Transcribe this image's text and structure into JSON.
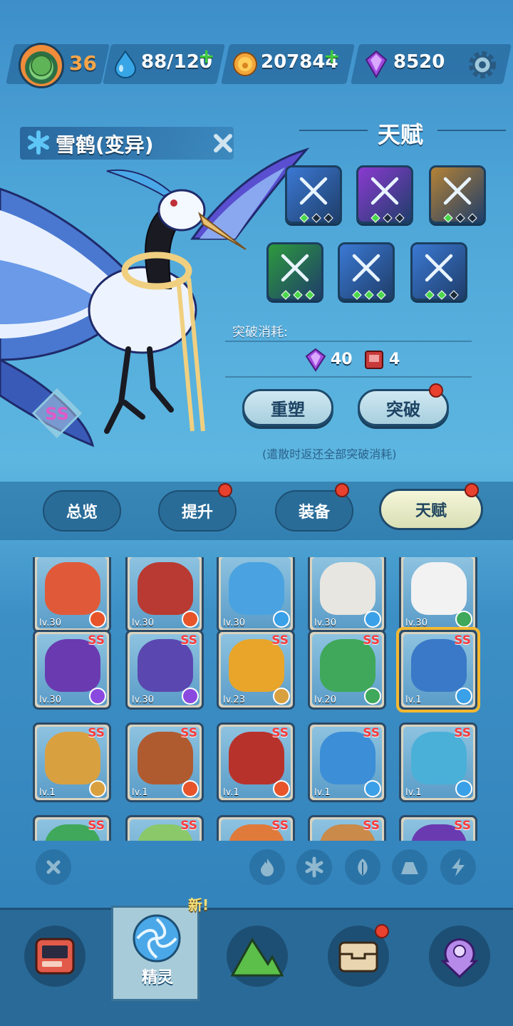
{
  "header": {
    "player_level": "36",
    "stamina": "88/120",
    "coins": "207844",
    "gems": "8520"
  },
  "creature": {
    "name": "雪鹤(变异)",
    "rank": "SS",
    "element": "ice"
  },
  "talent": {
    "title": "天赋",
    "skills": [
      {
        "icon": "x-slash-icon",
        "color": "#3b79d4",
        "filled_dots": 1
      },
      {
        "icon": "purple-slash-icon",
        "color": "#8a3ad0",
        "filled_dots": 1
      },
      {
        "icon": "golden-bowl-icon",
        "color": "#b58235",
        "filled_dots": 1
      },
      {
        "icon": "green-claw-icon",
        "color": "#2d9a3e",
        "filled_dots": 3
      },
      {
        "icon": "x-slash-icon",
        "color": "#3b79d4",
        "filled_dots": 3
      },
      {
        "icon": "ice-spike-icon",
        "color": "#3b79d4",
        "filled_dots": 2
      }
    ],
    "cost_label": "突破消耗:",
    "cost_gems": "40",
    "cost_books": "4",
    "reforge_label": "重塑",
    "breakthrough_label": "突破",
    "note": "(遣散时返还全部突破消耗)"
  },
  "tabs": [
    {
      "label": "总览",
      "badge": false
    },
    {
      "label": "提升",
      "badge": true
    },
    {
      "label": "装备",
      "badge": true
    },
    {
      "label": "天赋",
      "badge": true,
      "active": true
    }
  ],
  "cards": [
    {
      "lv": "lv.30",
      "ss": "",
      "color": "#e05a3a",
      "bg": "#f0c46a",
      "element": "fire"
    },
    {
      "lv": "lv.30",
      "ss": "",
      "color": "#b83a32",
      "bg": "#f0c46a",
      "element": "fire"
    },
    {
      "lv": "lv.30",
      "ss": "",
      "color": "#4aa3e0",
      "bg": "#f0c46a",
      "element": "ice"
    },
    {
      "lv": "lv.30",
      "ss": "",
      "color": "#e8e6e0",
      "bg": "#f0c46a",
      "element": "ice"
    },
    {
      "lv": "lv.30",
      "ss": "",
      "color": "#f2f2f2",
      "bg": "#f0c46a",
      "element": "leaf"
    },
    {
      "lv": "lv.30",
      "ss": "SS",
      "color": "#6a3ab0",
      "bg": "#f0c46a",
      "element": "electric"
    },
    {
      "lv": "lv.30",
      "ss": "SS",
      "color": "#5a48b0",
      "bg": "#f0c46a",
      "element": "electric"
    },
    {
      "lv": "lv.23",
      "ss": "SS",
      "color": "#e8a52a",
      "bg": "#f0c46a",
      "element": "earth"
    },
    {
      "lv": "lv.20",
      "ss": "SS",
      "color": "#3fa85a",
      "bg": "#f0c46a",
      "element": "leaf"
    },
    {
      "lv": "lv.1",
      "ss": "SS",
      "color": "#3a78c8",
      "bg": "#f0c46a",
      "element": "ice"
    },
    {
      "lv": "lv.1",
      "ss": "SS",
      "color": "#d9a040",
      "bg": "#f0c46a",
      "element": "earth"
    },
    {
      "lv": "lv.1",
      "ss": "SS",
      "color": "#b05a30",
      "bg": "#f0c46a",
      "element": "fire"
    },
    {
      "lv": "lv.1",
      "ss": "SS",
      "color": "#b8322c",
      "bg": "#f0c46a",
      "element": "fire"
    },
    {
      "lv": "lv.1",
      "ss": "SS",
      "color": "#3c8ed6",
      "bg": "#f0c46a",
      "element": "ice"
    },
    {
      "lv": "lv.1",
      "ss": "SS",
      "color": "#4ab0d8",
      "bg": "#f0c46a",
      "element": "ice"
    },
    {
      "lv": "",
      "ss": "SS",
      "color": "#3fa85a",
      "bg": "#f0c46a",
      "element": ""
    },
    {
      "lv": "",
      "ss": "SS",
      "color": "#8ac86a",
      "bg": "#f0c46a",
      "element": ""
    },
    {
      "lv": "",
      "ss": "SS",
      "color": "#e07a3a",
      "bg": "#f0c46a",
      "element": ""
    },
    {
      "lv": "",
      "ss": "SS",
      "color": "#c98a4a",
      "bg": "#f0c46a",
      "element": ""
    },
    {
      "lv": "",
      "ss": "SS",
      "color": "#6a3ab0",
      "bg": "#f0c46a",
      "element": ""
    }
  ],
  "bottom_nav": {
    "active_label": "精灵",
    "new_tag": "新!"
  }
}
